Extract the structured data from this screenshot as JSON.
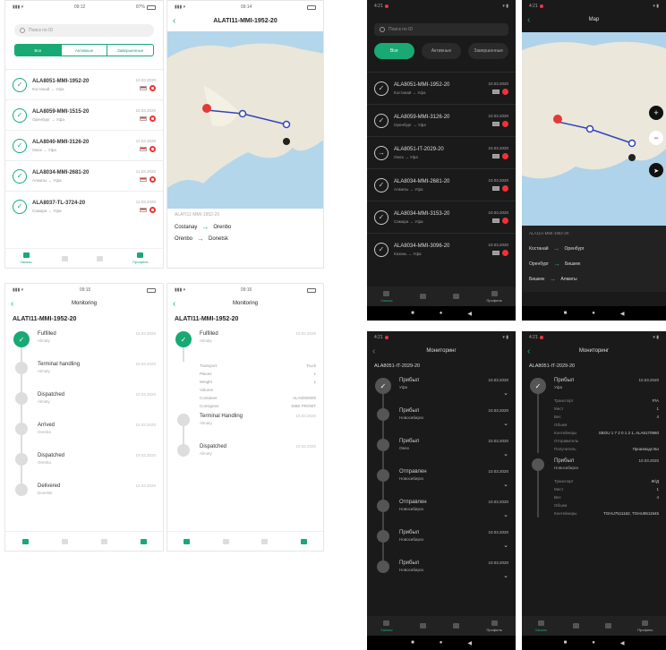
{
  "accent": "#19a974",
  "list_light": {
    "time": "09:12",
    "battery": "87%",
    "search_placeholder": "Поиск по ID",
    "tabs": [
      "Все",
      "Активные",
      "Завершенные"
    ],
    "rows": [
      {
        "id": "ALA8051-MMI-1952-20",
        "sub": "Костанай → Уфа",
        "date": "10.03.2020"
      },
      {
        "id": "ALA8059-MMI-1515-20",
        "sub": "Оренбург → Уфа",
        "date": "10.03.2020"
      },
      {
        "id": "ALA8040-MMI-3126-20",
        "sub": "Омск → Уфа",
        "date": "11.03.2020"
      },
      {
        "id": "ALA8034-MMI-2681-20",
        "sub": "Алматы → Уфа",
        "date": "11.03.2020"
      },
      {
        "id": "ALA8037-TL-3724-20",
        "sub": "Самара → Уфа",
        "date": "11.03.2020"
      }
    ],
    "nav": [
      "Заказы",
      "",
      "",
      "Профиль"
    ]
  },
  "map_light": {
    "time": "09:14",
    "title": "ALATI11-MMI-1952-20",
    "caption": "ALATI11-MMI-1952-20",
    "legs": [
      [
        "Costanay",
        "Orenbo"
      ],
      [
        "Orenbo",
        "Donetsk"
      ]
    ]
  },
  "mon_light1": {
    "time": "09:15",
    "title": "Monitoring",
    "id": "ALATI11-MMI-1952-20",
    "steps": [
      {
        "name": "Fulfilled",
        "sub": "Almaty",
        "date": "10.03.2020",
        "done": true
      },
      {
        "name": "Terminal handling",
        "sub": "Almaty",
        "date": "10.03.2020",
        "done": false
      },
      {
        "name": "Dispatched",
        "sub": "Almaty",
        "date": "10.03.2020",
        "done": false
      },
      {
        "name": "Arrived",
        "sub": "Orenbo",
        "date": "10.03.2020",
        "done": false
      },
      {
        "name": "Dispatched",
        "sub": "Orenbo",
        "date": "10.03.2020",
        "done": false
      },
      {
        "name": "Delivered",
        "sub": "Donetsk",
        "date": "10.03.2020",
        "done": false
      }
    ]
  },
  "mon_light2": {
    "time": "09:16",
    "title": "Monitoring",
    "id": "ALATI11-MMI-1952-20",
    "details": [
      [
        "Transport",
        "Truck"
      ],
      [
        "Places",
        "1"
      ],
      [
        "Weight",
        "1"
      ],
      [
        "Volume",
        ""
      ],
      [
        "Container",
        "ALA0000000"
      ],
      [
        "Consignee",
        "SIBE PROMT"
      ]
    ],
    "steps": [
      {
        "name": "Fulfilled",
        "sub": "Almaty",
        "date": "10.03.2020",
        "done": true
      },
      {
        "name": "Terminal Handling",
        "sub": "Almaty",
        "date": "10.03.2020",
        "done": false
      },
      {
        "name": "Dispatched",
        "sub": "Almaty",
        "date": "10.03.2020",
        "done": false
      }
    ]
  },
  "list_dark": {
    "time": "4:21",
    "search_placeholder": "Поиск по ID",
    "tabs": [
      "Все",
      "Активные",
      "Завершенные"
    ],
    "rows": [
      {
        "id": "ALA8051-MMI-1952-20",
        "sub": "Костанай → Уфа",
        "date": "10.03.2020"
      },
      {
        "id": "ALA8059-MMI-3126-20",
        "sub": "Оренбург → Уфа",
        "date": "10.03.2020"
      },
      {
        "id": "ALA8051-IT-2029-20",
        "sub": "Омск → Уфа",
        "date": "10.03.2020"
      },
      {
        "id": "ALA8034-MMI-2681-20",
        "sub": "Алматы → Уфа",
        "date": "10.03.2020"
      },
      {
        "id": "ALA8034-MMI-3153-20",
        "sub": "Самара → Уфа",
        "date": "10.03.2020"
      },
      {
        "id": "ALA8034-MMI-3096-20",
        "sub": "Казань → Уфа",
        "date": "10.03.2020"
      }
    ],
    "nav": [
      "Заказы",
      "",
      "",
      "Профиль"
    ]
  },
  "map_dark": {
    "time": "4:21",
    "title": "Map",
    "caption": "ALA11A-MMI-1952-20",
    "legs": [
      [
        "Костанай",
        "Оренбург"
      ],
      [
        "Оренбург",
        "Бишкек"
      ],
      [
        "Бишкек",
        "Алматы"
      ]
    ]
  },
  "mon_dark1": {
    "time": "4:21",
    "title": "Мониторинг",
    "id": "ALA8051-IT-2029-20",
    "steps": [
      {
        "name": "Прибыл",
        "sub": "Уфа",
        "date": "10.03.2020",
        "done": true
      },
      {
        "name": "Прибыл",
        "sub": "Новосибирск",
        "date": "10.03.2020",
        "done": false
      },
      {
        "name": "Прибыл",
        "sub": "Омск",
        "date": "10.03.2020",
        "done": false
      },
      {
        "name": "Отправлен",
        "sub": "Новосибирск",
        "date": "10.03.2020",
        "done": false
      },
      {
        "name": "Отправлен",
        "sub": "Новосибирск",
        "date": "10.03.2020",
        "done": false
      },
      {
        "name": "Прибыл",
        "sub": "Новосибирск",
        "date": "10.03.2020",
        "done": false
      },
      {
        "name": "Прибыл",
        "sub": "Новосибирск",
        "date": "10.03.2020",
        "done": false
      }
    ],
    "nav": [
      "Заказы",
      "",
      "",
      "Профиль"
    ]
  },
  "mon_dark2": {
    "time": "4:21",
    "title": "Мониторинг",
    "id": "ALA8051-IT-2029-20",
    "step1": {
      "name": "Прибыл",
      "sub": "Уфа",
      "date": "10.03.2020"
    },
    "details1": [
      [
        "Транспорт",
        "Р/А"
      ],
      [
        "Мест",
        "1"
      ],
      [
        "Вес",
        "4"
      ],
      [
        "Объем",
        ""
      ],
      [
        "Контейнеры",
        "SBOU 1 7 2 0 1 2 1, ALA6170960"
      ],
      [
        "Отправитель",
        ""
      ],
      [
        "Получатель",
        "Производство"
      ]
    ],
    "step2": {
      "name": "Прибыл",
      "sub": "Новосибирск",
      "date": "10.03.2020"
    },
    "details2": [
      [
        "Транспорт",
        "Ж/Д"
      ],
      [
        "Мест",
        "1"
      ],
      [
        "Вес",
        "4"
      ],
      [
        "Объем",
        ""
      ],
      [
        "Контейнеры",
        "TGHU7511162, TGHU9511945"
      ]
    ],
    "nav": [
      "Заказы",
      "",
      "",
      "Профиль"
    ]
  }
}
